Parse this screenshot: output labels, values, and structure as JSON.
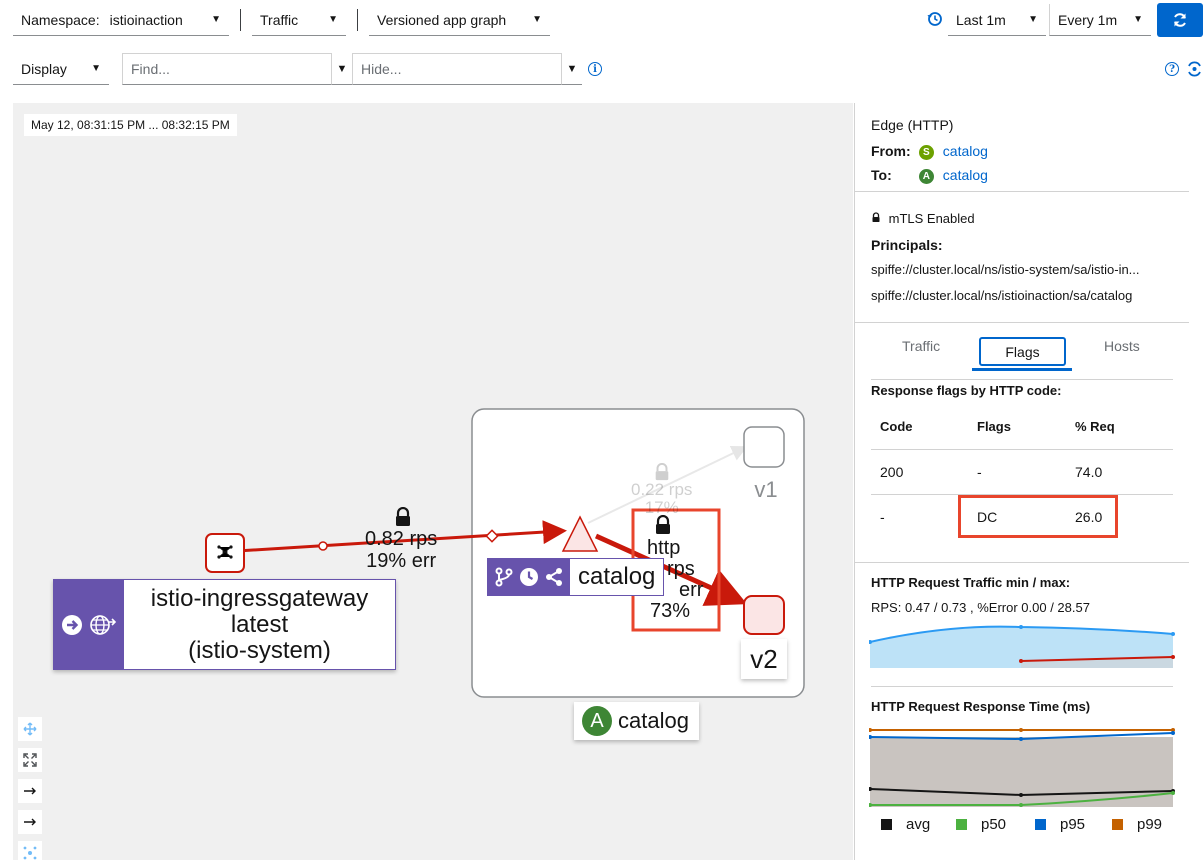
{
  "toolbar": {
    "namespace_label": "Namespace:",
    "namespace_value": "istioinaction",
    "traffic_label": "Traffic",
    "graph_type": "Versioned app graph",
    "time_range": "Last 1m",
    "refresh_interval": "Every 1m",
    "display_label": "Display",
    "find_placeholder": "Find...",
    "hide_placeholder": "Hide..."
  },
  "graph": {
    "timestamp": "May 12, 08:31:15 PM ... 08:32:15 PM",
    "gateway": {
      "name": "istio-ingressgateway",
      "version": "latest",
      "namespace": "(istio-system)"
    },
    "edge_main": {
      "rps": "0.82 rps",
      "err": "19% err"
    },
    "edge_faded": {
      "rps": "0.22 rps",
      "err": "17%"
    },
    "edge_v2": {
      "proto": "http",
      "rps": "rps",
      "err": "err",
      "pct": "73%"
    },
    "service_label": "catalog",
    "node_v1": "v1",
    "node_v2": "v2",
    "app_box_label": "catalog",
    "app_badge": "A"
  },
  "panel": {
    "edge_title": "Edge (HTTP)",
    "from_label": "From:",
    "from_badge": "S",
    "from_value": "catalog",
    "to_label": "To:",
    "to_badge": "A",
    "to_value": "catalog",
    "mtls": "mTLS Enabled",
    "principals_label": "Principals:",
    "principal_1": "spiffe://cluster.local/ns/istio-system/sa/istio-in...",
    "principal_2": "spiffe://cluster.local/ns/istioinaction/sa/catalog",
    "tabs": [
      "Traffic",
      "Flags",
      "Hosts"
    ],
    "flags_title": "Response flags by HTTP code:",
    "table": {
      "headers": [
        "Code",
        "Flags",
        "% Req"
      ],
      "rows": [
        [
          "200",
          "-",
          "74.0"
        ],
        [
          "-",
          "DC",
          "26.0"
        ]
      ]
    },
    "traffic_title": "HTTP Request Traffic min / max:",
    "traffic_stats": "RPS: 0.47 / 0.73 , %Error 0.00 / 28.57",
    "response_title": "HTTP Request Response Time (ms)",
    "legend": [
      {
        "name": "avg",
        "color": "#151515"
      },
      {
        "name": "p50",
        "color": "#4cb140"
      },
      {
        "name": "p95",
        "color": "#0066cc"
      },
      {
        "name": "p99",
        "color": "#c46100"
      }
    ]
  },
  "colors": {
    "accent": "#0066cc",
    "error": "#c9190b",
    "highlight": "#e8452c",
    "node_purple": "#6753ac"
  }
}
